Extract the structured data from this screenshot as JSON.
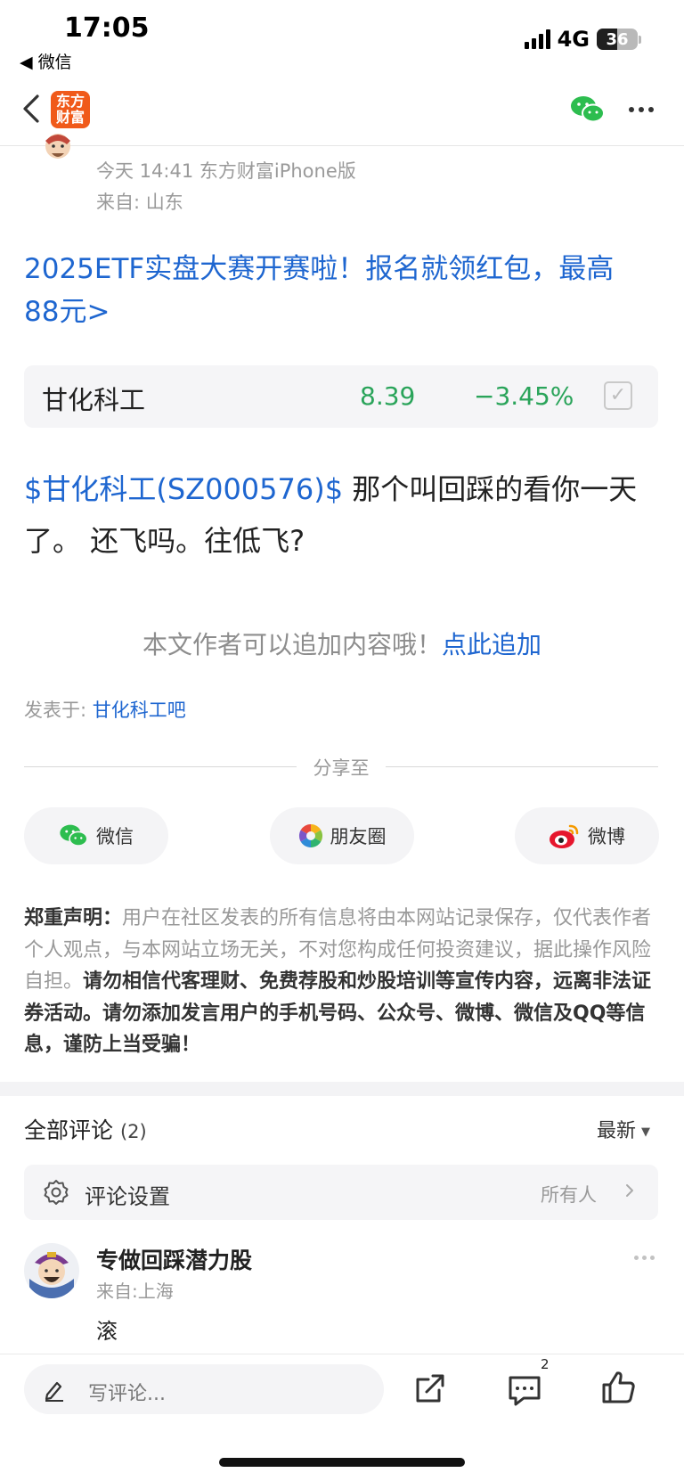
{
  "status_bar": {
    "time": "17:05",
    "back_app": "◀ 微信",
    "network": "4G",
    "battery": "36"
  },
  "nav": {
    "logo_text": "东方财富"
  },
  "post": {
    "meta_time": "今天 14:41 东方财富iPhone版",
    "meta_from": "来自: 山东",
    "promo": "2025ETF实盘大赛开赛啦！报名就领红包，最高88元>",
    "stock": {
      "name": "甘化科工",
      "price": "8.39",
      "change": "−3.45%",
      "color": "#2aa45a"
    },
    "body_tag": "$甘化科工(SZ000576)$",
    "body_text": " 那个叫回踩的看你一天了。 还飞吗。往低飞?",
    "append_prompt": "本文作者可以追加内容哦！",
    "append_link": "点此追加",
    "posted_in_label": "发表于: ",
    "posted_in_link": "甘化科工吧"
  },
  "share": {
    "title": "分享至",
    "wechat": "微信",
    "moments": "朋友圈",
    "weibo": "微博"
  },
  "disclaimer": {
    "lead": "郑重声明：",
    "normal": "用户在社区发表的所有信息将由本网站记录保存，仅代表作者个人观点，与本网站立场无关，不对您构成任何投资建议，据此操作风险自担。",
    "bold": "请勿相信代客理财、免费荐股和炒股培训等宣传内容，远离非法证券活动。请勿添加发言用户的手机号码、公众号、微博、微信及QQ等信息，谨防上当受骗！"
  },
  "comments": {
    "title": "全部评论",
    "count": "(2)",
    "sort": "最新",
    "settings_label": "评论设置",
    "settings_value": "所有人",
    "items": [
      {
        "name": "专做回踩潜力股",
        "from": "来自:上海",
        "text": "滚"
      }
    ]
  },
  "bottom_bar": {
    "placeholder": "写评论...",
    "comment_badge": "2"
  },
  "colors": {
    "link": "#1e66d0",
    "brand": "#f05a1a",
    "down": "#2aa45a"
  }
}
